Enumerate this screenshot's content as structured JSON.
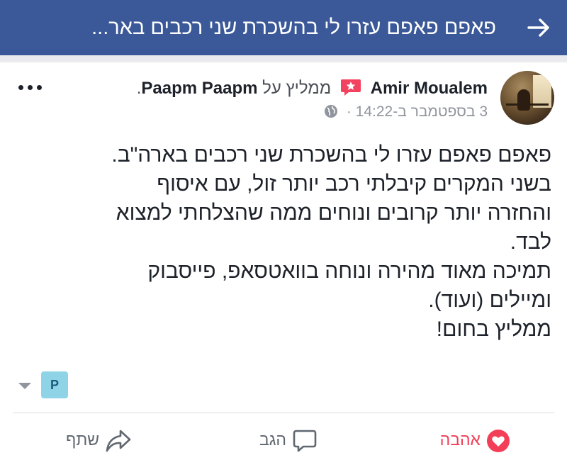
{
  "header": {
    "title": "פאפם פאפם עזרו לי בהשכרת שני רכבים באר...",
    "back_icon": "arrow-right-icon",
    "background": "#3b5998"
  },
  "post": {
    "author": "Amir Moualem",
    "recommend_icon": "recommendation-star-icon",
    "verb": "ממליץ על",
    "page_name": "Paapm Paapm",
    "page_suffix": ".",
    "timestamp": "3 בספטמבר ב-14:22",
    "timestamp_separator": "·",
    "privacy_icon": "globe-icon",
    "more_icon": "more-dots-icon",
    "body_lines": [
      "פאפם פאפם עזרו לי בהשכרת שני רכבים בארה\"ב.",
      "בשני המקרים קיבלתי רכב יותר זול, עם איסוף",
      "והחזרה יותר קרובים ונוחים ממה שהצלחתי למצוא",
      "לבד.",
      "תמיכה מאוד מהירה ונוחה בוואטסאפ, פייסבוק",
      "ומיילים (ועוד).",
      "ממליץ בחום!"
    ],
    "page_badge_letter": "P",
    "badge_color": "#8fd3e6"
  },
  "actions": {
    "love_label": "אהבה",
    "comment_label": "הגב",
    "share_label": "שתף",
    "love_color": "#f33e58"
  }
}
